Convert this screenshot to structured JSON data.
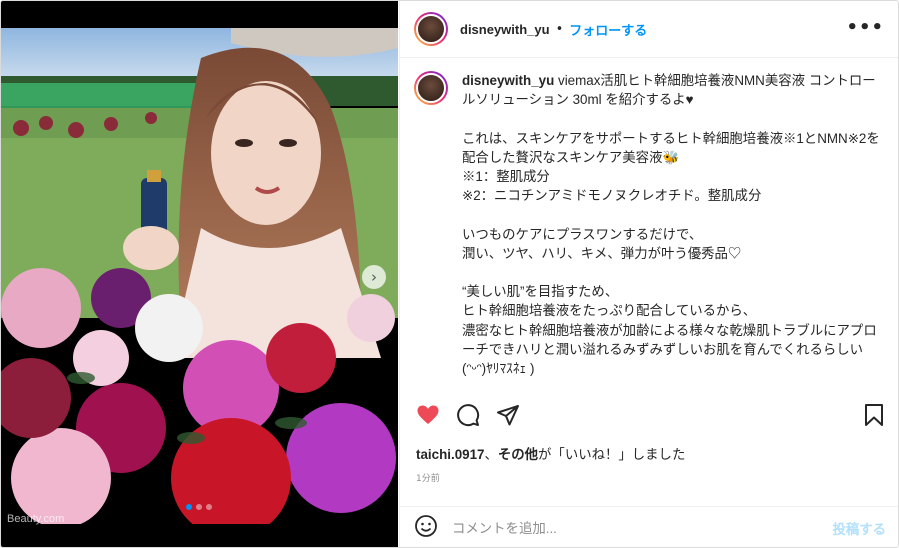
{
  "post": {
    "username": "disneywith_yu",
    "separator": "•",
    "follow_label": "フォローする",
    "more_label": "•••",
    "caption_text": " viemax活肌ヒト幹細胞培養液NMN美容液 コントロールソリューション 30ml を紹介するよ♥\n\nこれは、スキンケアをサポートするヒト幹細胞培養液※1とNMN※2を配合した贅沢なスキンケア美容液🐝\n※1：整肌成分\n※2：ニコチンアミドモノヌクレオチド。整肌成分\n\nいつものケアにプラスワンするだけで、\n潤い、ツヤ、ハリ、キメ、弾力が叶う優秀品♡\n\n“美しい肌”を目指すため、\nヒト幹細胞培養液をたっぷり配合しているから、\n濃密なヒト幹細胞培養液が加齢による様々な乾燥肌トラブルにアプローチできハリと潤い溢れるみずみずしいお肌を育んでくれるらしい(ᵔᵕᵔ)ﾔﾘﾏｽﾈｪ )",
    "likes_user": "taichi.0917",
    "likes_middle": "、",
    "likes_others": "その他",
    "likes_suffix": "が「いいね！」しました",
    "time_ago": "1分前",
    "comment_placeholder": "コメントを追加...",
    "post_button": "投稿する",
    "watermark": "Beauty.com",
    "next_label": "›"
  },
  "carousel": {
    "total": 3,
    "current": 1
  },
  "icons": [
    "heart-icon",
    "comment-icon",
    "share-icon",
    "bookmark-icon",
    "emoji-icon",
    "more-options-icon",
    "chevron-right-icon"
  ],
  "colors": {
    "accent": "#0095f6",
    "like": "#ed4956",
    "post_disabled": "#b2dffc",
    "text": "#262626",
    "muted": "#8e8e8e"
  }
}
